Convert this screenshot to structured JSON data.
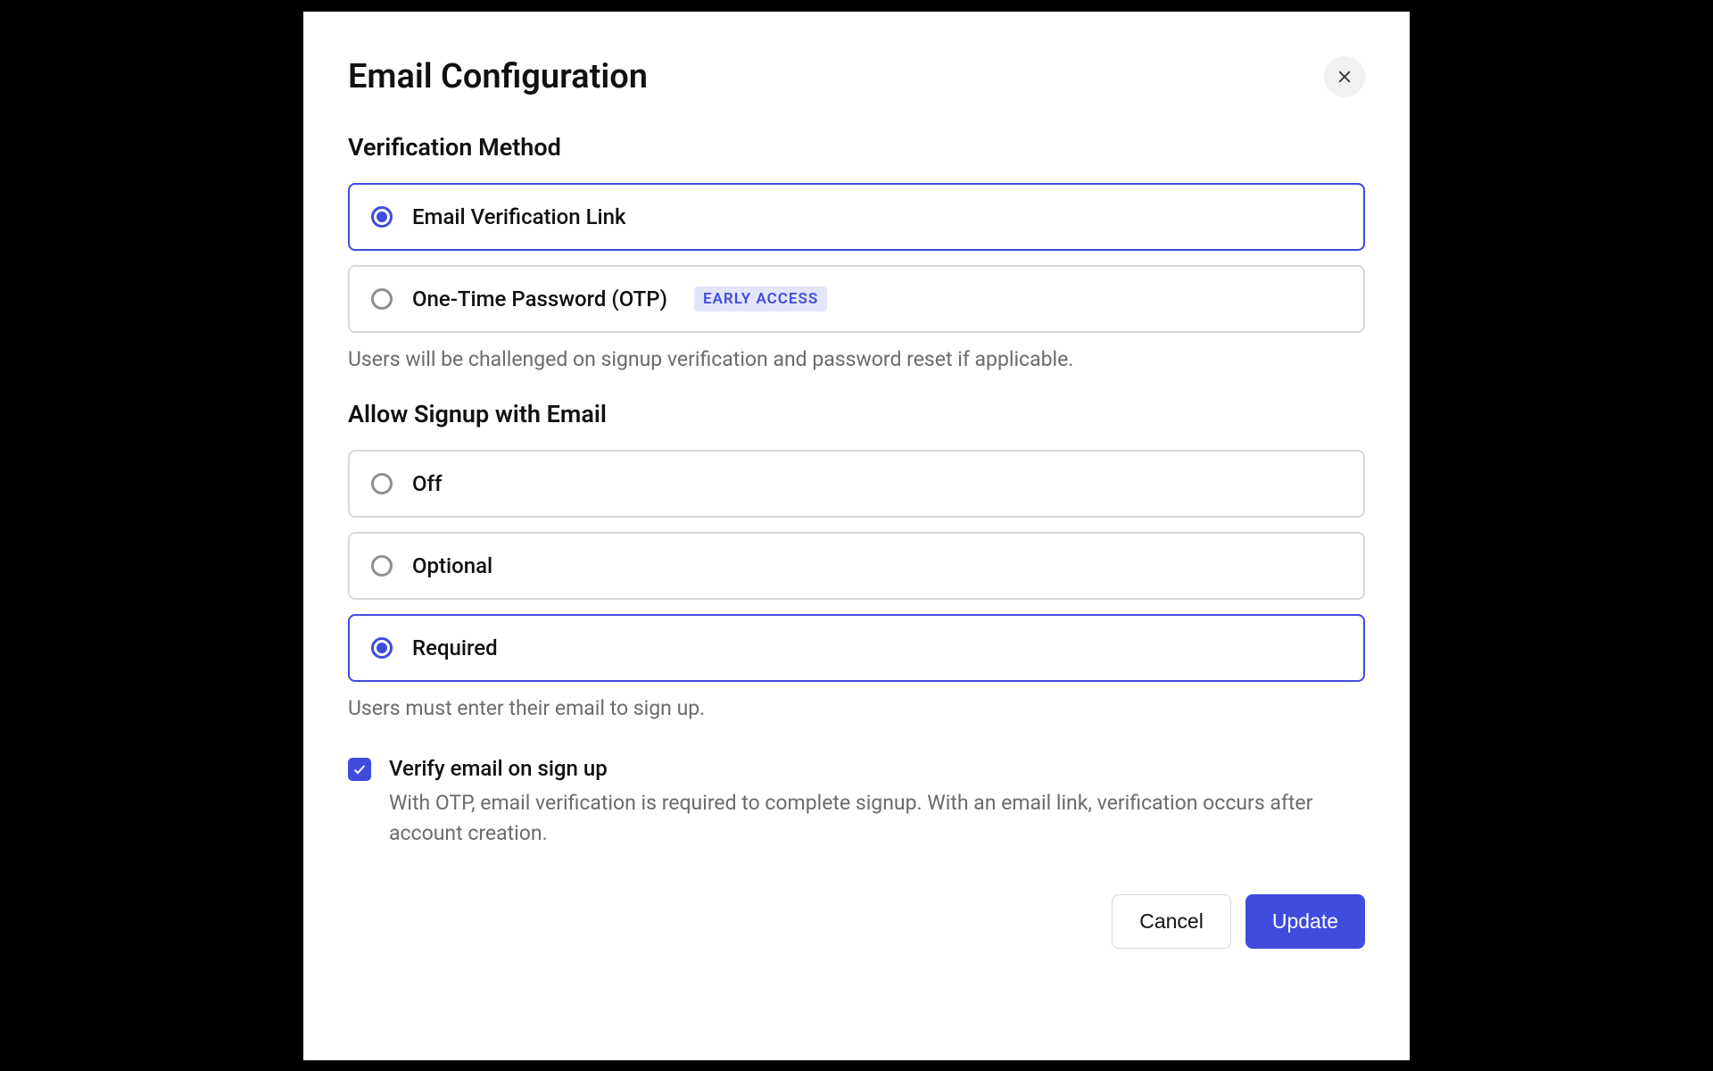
{
  "dialog": {
    "title": "Email Configuration",
    "verification": {
      "title": "Verification Method",
      "options": {
        "link": "Email Verification Link",
        "otp": "One-Time Password (OTP)",
        "otp_badge": "EARLY ACCESS"
      },
      "helper": "Users will be challenged on signup verification and password reset if applicable."
    },
    "signup": {
      "title": "Allow Signup with Email",
      "options": {
        "off": "Off",
        "optional": "Optional",
        "required": "Required"
      },
      "helper": "Users must enter their email to sign up."
    },
    "verify_checkbox": {
      "label": "Verify email on sign up",
      "description": "With OTP, email verification is required to complete signup. With an email link, verification occurs after account creation."
    },
    "buttons": {
      "cancel": "Cancel",
      "update": "Update"
    }
  }
}
